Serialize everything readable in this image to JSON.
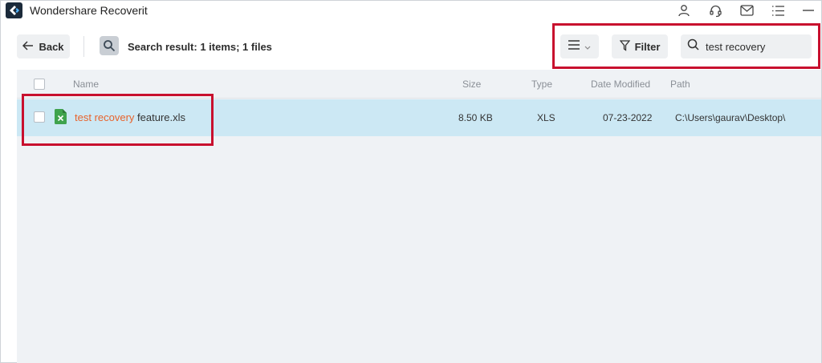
{
  "window": {
    "title": "Wondershare Recoverit"
  },
  "titlebar_icons": [
    "user-icon",
    "headset-icon",
    "mail-icon",
    "menu-list-icon",
    "minimize-icon"
  ],
  "toolbar": {
    "back_label": "Back",
    "search_result": "Search result: 1 items; 1 files",
    "filter_label": "Filter",
    "search_value": "test recovery"
  },
  "table": {
    "columns": {
      "name": "Name",
      "size": "Size",
      "type": "Type",
      "date_modified": "Date Modified",
      "path": "Path"
    },
    "rows": [
      {
        "name_highlight": "test recovery",
        "name_rest": " feature.xls",
        "size": "8.50 KB",
        "type": "XLS",
        "date_modified": "07-23-2022",
        "path": "C:\\Users\\gaurav\\Desktop\\",
        "selected": false
      }
    ]
  },
  "colors": {
    "highlight_text": "#e8632c",
    "selected_row": "#cce8f4",
    "annotation": "#c8102e",
    "panel_bg": "#eff2f5"
  }
}
